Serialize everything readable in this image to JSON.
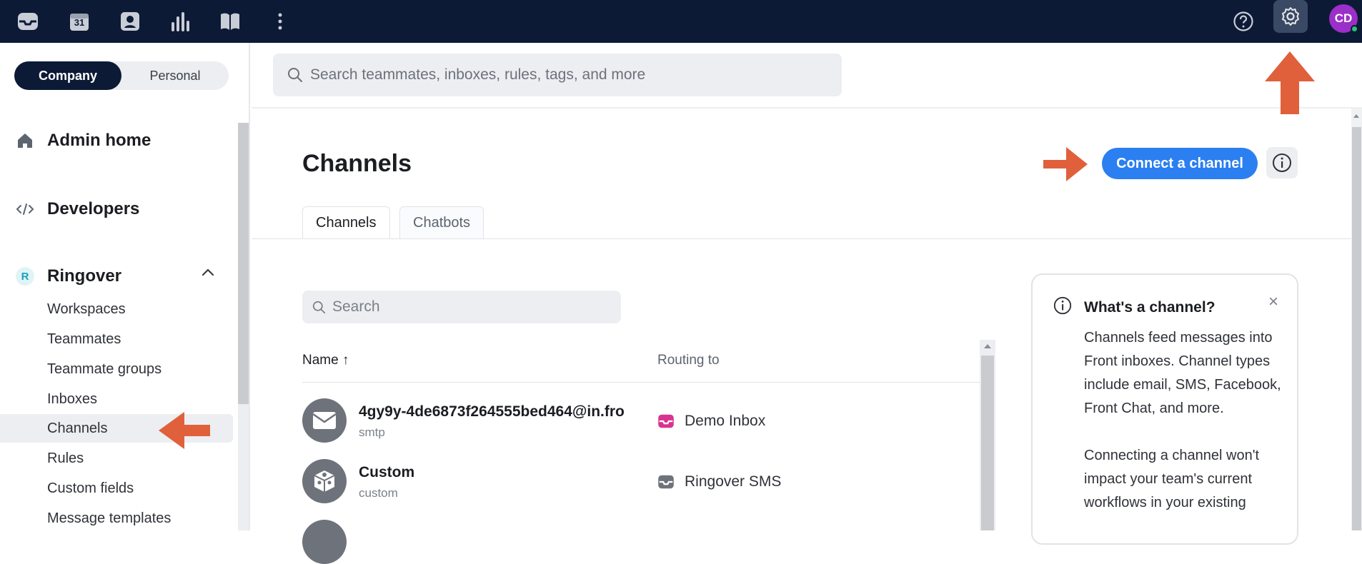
{
  "topbar": {
    "calendar_day": "31",
    "avatar_initials": "CD",
    "icons": [
      "inbox-icon",
      "calendar-icon",
      "contacts-icon",
      "analytics-icon",
      "knowledge-base-icon",
      "more-icon",
      "help-icon",
      "settings-icon"
    ]
  },
  "sidebar": {
    "toggle": {
      "company": "Company",
      "personal": "Personal"
    },
    "admin_home": "Admin home",
    "developers": "Developers",
    "workspace": {
      "badge": "R",
      "name": "Ringover"
    },
    "items": [
      {
        "label": "Workspaces"
      },
      {
        "label": "Teammates"
      },
      {
        "label": "Teammate groups"
      },
      {
        "label": "Inboxes"
      },
      {
        "label": "Channels"
      },
      {
        "label": "Rules"
      },
      {
        "label": "Custom fields"
      },
      {
        "label": "Message templates"
      }
    ]
  },
  "search": {
    "placeholder": "Search teammates, inboxes, rules, tags, and more"
  },
  "main": {
    "title": "Channels",
    "connect_button": "Connect a channel",
    "tabs": [
      {
        "label": "Channels"
      },
      {
        "label": "Chatbots"
      }
    ],
    "list_search_placeholder": "Search",
    "columns": {
      "name": "Name ↑",
      "routing": "Routing to"
    },
    "rows": [
      {
        "name": "4gy9y-4de6873f264555bed464@in.fro",
        "type": "smtp",
        "routing": "Demo Inbox",
        "routing_color": "#d9338f"
      },
      {
        "name": "Custom",
        "type": "custom",
        "routing": "Ringover SMS",
        "routing_color": "#6e737b"
      }
    ]
  },
  "info_card": {
    "title": "What's a channel?",
    "close": "×",
    "para1": "Channels feed messages into Front inboxes. Channel types include email, SMS, Facebook, Front Chat, and more.",
    "para2": "Connecting a channel won't impact your team's current workflows in your existing"
  },
  "colors": {
    "topbar": "#0c1a36",
    "accent": "#2b7ff0",
    "annotation_arrow": "#e0603c"
  }
}
